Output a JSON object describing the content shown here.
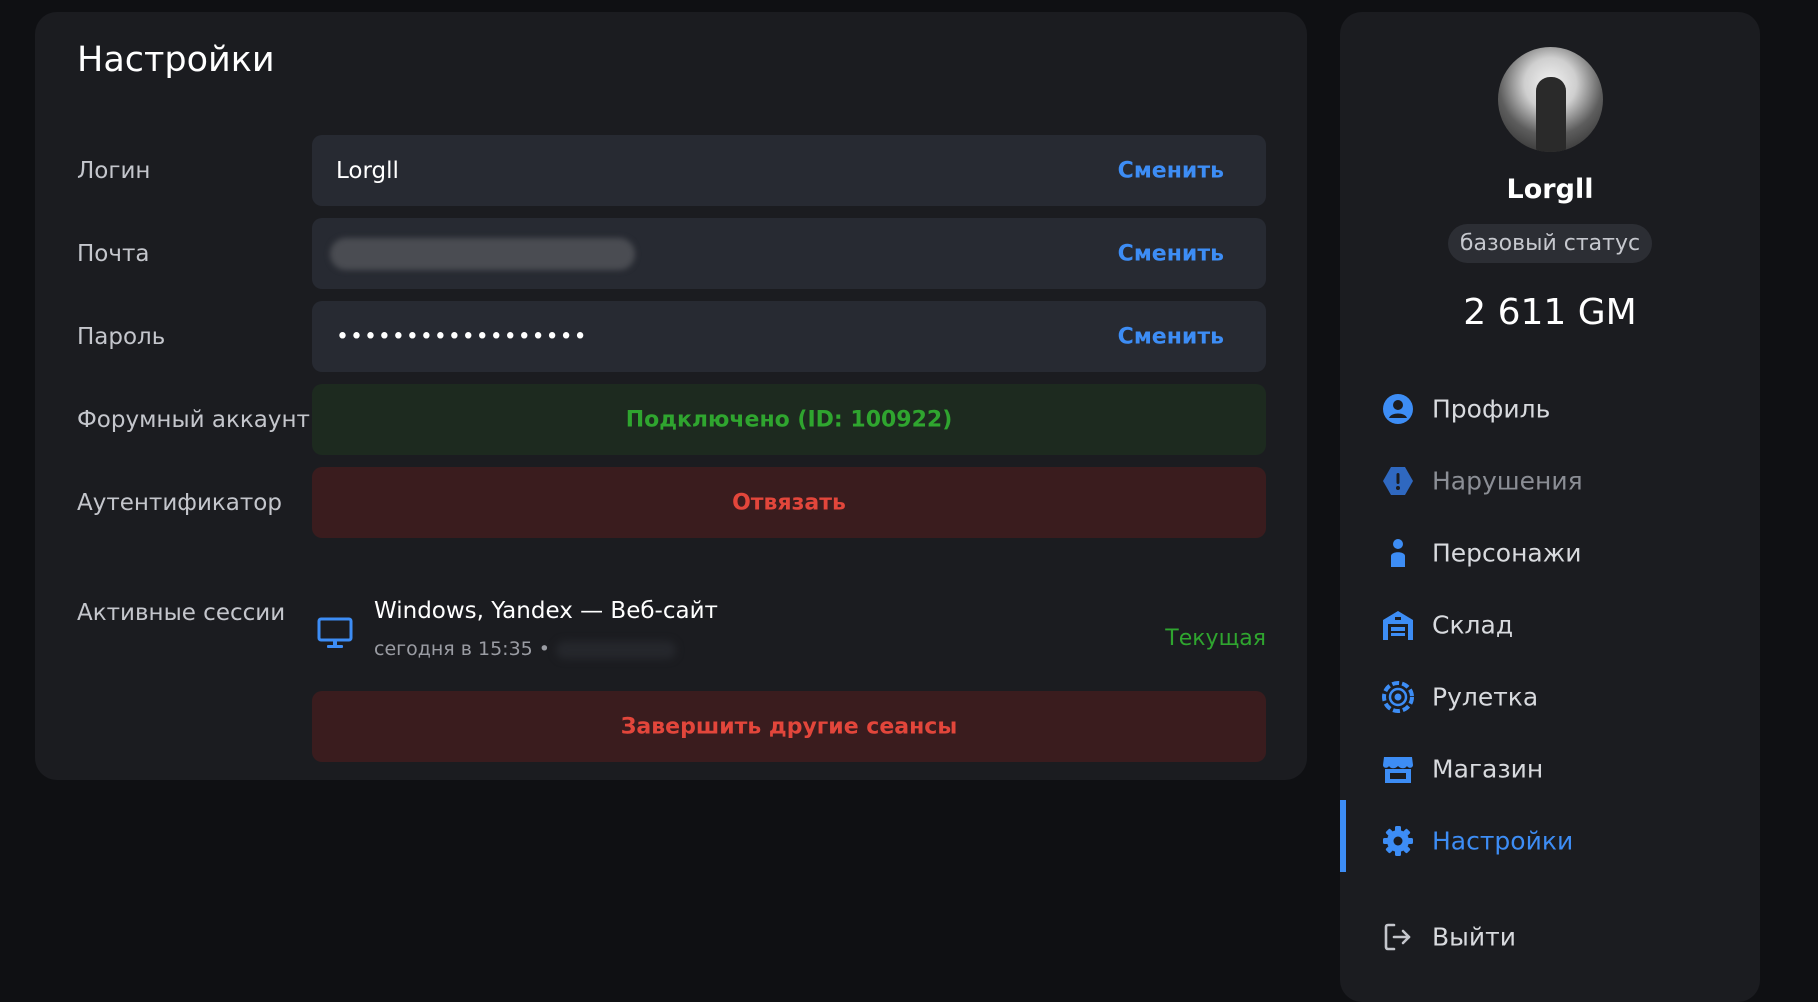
{
  "settings": {
    "title": "Настройки",
    "login": {
      "label": "Логин",
      "value": "Lorgll",
      "action": "Сменить"
    },
    "email": {
      "label": "Почта",
      "action": "Сменить"
    },
    "password": {
      "label": "Пароль",
      "value": "••••••••••••••••••",
      "action": "Сменить"
    },
    "forum": {
      "label": "Форумный аккаунт",
      "status": "Подключено (ID: 100922)"
    },
    "authenticator": {
      "label": "Аутентификатор",
      "action": "Отвязать"
    },
    "sessions": {
      "label": "Активные сессии",
      "items": [
        {
          "title": "Windows, Yandex — Веб-сайт",
          "meta": "сегодня в 15:35 •",
          "badge": "Текущая"
        }
      ],
      "end_others": "Завершить другие сеансы"
    }
  },
  "profile": {
    "name": "Lorgll",
    "status": "базовый статус",
    "balance": "2 611 GM"
  },
  "nav": {
    "items": [
      {
        "label": "Профиль",
        "icon": "user-circle-icon"
      },
      {
        "label": "Нарушения",
        "icon": "warning-hexagon-icon"
      },
      {
        "label": "Персонажи",
        "icon": "person-icon"
      },
      {
        "label": "Склад",
        "icon": "warehouse-icon"
      },
      {
        "label": "Рулетка",
        "icon": "roulette-icon"
      },
      {
        "label": "Магазин",
        "icon": "store-icon"
      },
      {
        "label": "Настройки",
        "icon": "gear-icon"
      },
      {
        "label": "Выйти",
        "icon": "logout-icon"
      }
    ]
  },
  "colors": {
    "accent": "#3d8df5",
    "success": "#2fa52f",
    "danger": "#e2463b"
  }
}
